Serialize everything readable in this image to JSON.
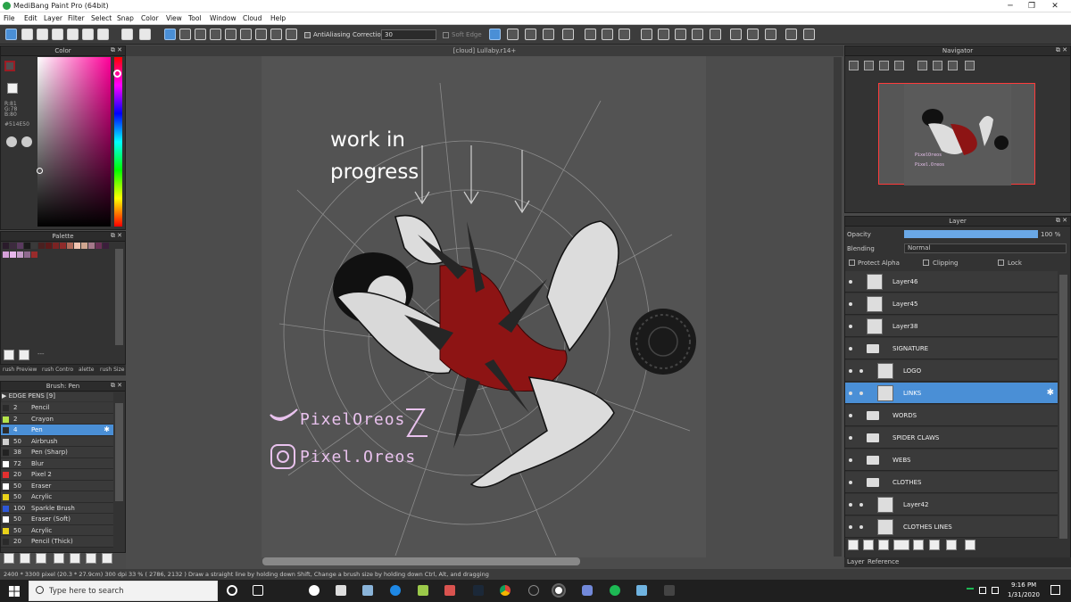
{
  "window": {
    "title": "MediBang Paint Pro (64bit)"
  },
  "menu": [
    "File",
    "Edit",
    "Layer",
    "Filter",
    "Select",
    "Snap",
    "Color",
    "View",
    "Tool",
    "Window",
    "Cloud",
    "Help"
  ],
  "toolbar": {
    "antialias_label": "AntiAliasing",
    "correction_label": "Correction",
    "correction_value": "30",
    "soft_edge_label": "Soft Edge"
  },
  "color_panel": {
    "title": "Color",
    "r": "R:81",
    "g": "G:78",
    "b": "B:80",
    "hex": "#514E50",
    "main_color": "#514e50",
    "outline_color": "#9b1c24"
  },
  "palette_panel": {
    "title": "Palette",
    "status": "---"
  },
  "sub_tabs": [
    "rush Preview",
    "rush Contro",
    "alette",
    "rush Size"
  ],
  "brush_panel": {
    "title": "Brush: Pen",
    "group": "EDGE PENS [9]",
    "brushes": [
      {
        "size": "2",
        "name": "Pencil",
        "color": "#2a2a2a"
      },
      {
        "size": "2",
        "name": "Crayon",
        "color": "#b5e34a"
      },
      {
        "size": "4",
        "name": "Pen",
        "color": "#2d2d2d"
      },
      {
        "size": "50",
        "name": "Airbrush",
        "color": "#cfcfcf"
      },
      {
        "size": "38",
        "name": "Pen (Sharp)",
        "color": "#222222"
      },
      {
        "size": "72",
        "name": "Blur",
        "color": "#ffffff"
      },
      {
        "size": "20",
        "name": "Pixel 2",
        "color": "#e33030"
      },
      {
        "size": "50",
        "name": "Eraser",
        "color": "#ffffff"
      },
      {
        "size": "50",
        "name": "Acrylic",
        "color": "#e9d21a"
      },
      {
        "size": "100",
        "name": "Sparkle Brush",
        "color": "#2f58d6"
      },
      {
        "size": "50",
        "name": "Eraser (Soft)",
        "color": "#ffffff"
      },
      {
        "size": "50",
        "name": "Acrylic",
        "color": "#e9d21a"
      },
      {
        "size": "20",
        "name": "Pencil (Thick)",
        "color": "#2a2a2a"
      }
    ]
  },
  "canvas": {
    "tab": "[cloud] Lullaby.r14+",
    "wip_line1": "work in",
    "wip_line2": "progress",
    "sig_twitter": "PixelOreos",
    "sig_insta": "Pixel.Oreos"
  },
  "navigator": {
    "title": "Navigator",
    "preview_twitter": "PixelOreos",
    "preview_insta": "Pixel.Oreos"
  },
  "layer_panel": {
    "title": "Layer",
    "opacity_label": "Opacity",
    "opacity_value": "100 %",
    "opacity_fraction": 1.0,
    "blending_label": "Blending",
    "blending_value": "Normal",
    "protect_alpha": "Protect Alpha",
    "clipping": "Clipping",
    "lock": "Lock",
    "layers": [
      {
        "name": "Layer46",
        "type": "layer",
        "indent": 0
      },
      {
        "name": "Layer45",
        "type": "layer",
        "indent": 0
      },
      {
        "name": "Layer38",
        "type": "layer",
        "indent": 0
      },
      {
        "name": "SIGNATURE",
        "type": "folder",
        "indent": 0
      },
      {
        "name": "LOGO",
        "type": "layer",
        "indent": 1
      },
      {
        "name": "LINKS",
        "type": "layer",
        "indent": 1
      },
      {
        "name": "WORDS",
        "type": "folder",
        "indent": 0
      },
      {
        "name": "SPIDER CLAWS",
        "type": "folder",
        "indent": 0
      },
      {
        "name": "WEBS",
        "type": "folder",
        "indent": 0
      },
      {
        "name": "CLOTHES",
        "type": "folder",
        "indent": 0
      },
      {
        "name": "Layer42",
        "type": "layer",
        "indent": 1
      },
      {
        "name": "CLOTHES LINES",
        "type": "layer",
        "indent": 1
      }
    ],
    "tabs": [
      "Layer",
      "Reference"
    ]
  },
  "status": {
    "text": "2400 * 3300 pixel   (20.3 * 27.9cm)   300 dpi   33 %   ( 2786, 2132 )   Draw a straight line by holding down Shift, Change a brush size by holding down Ctrl, Alt, and dragging"
  },
  "taskbar": {
    "search_placeholder": "Type here to search",
    "time": "9:16 PM",
    "date": "1/31/2020"
  }
}
